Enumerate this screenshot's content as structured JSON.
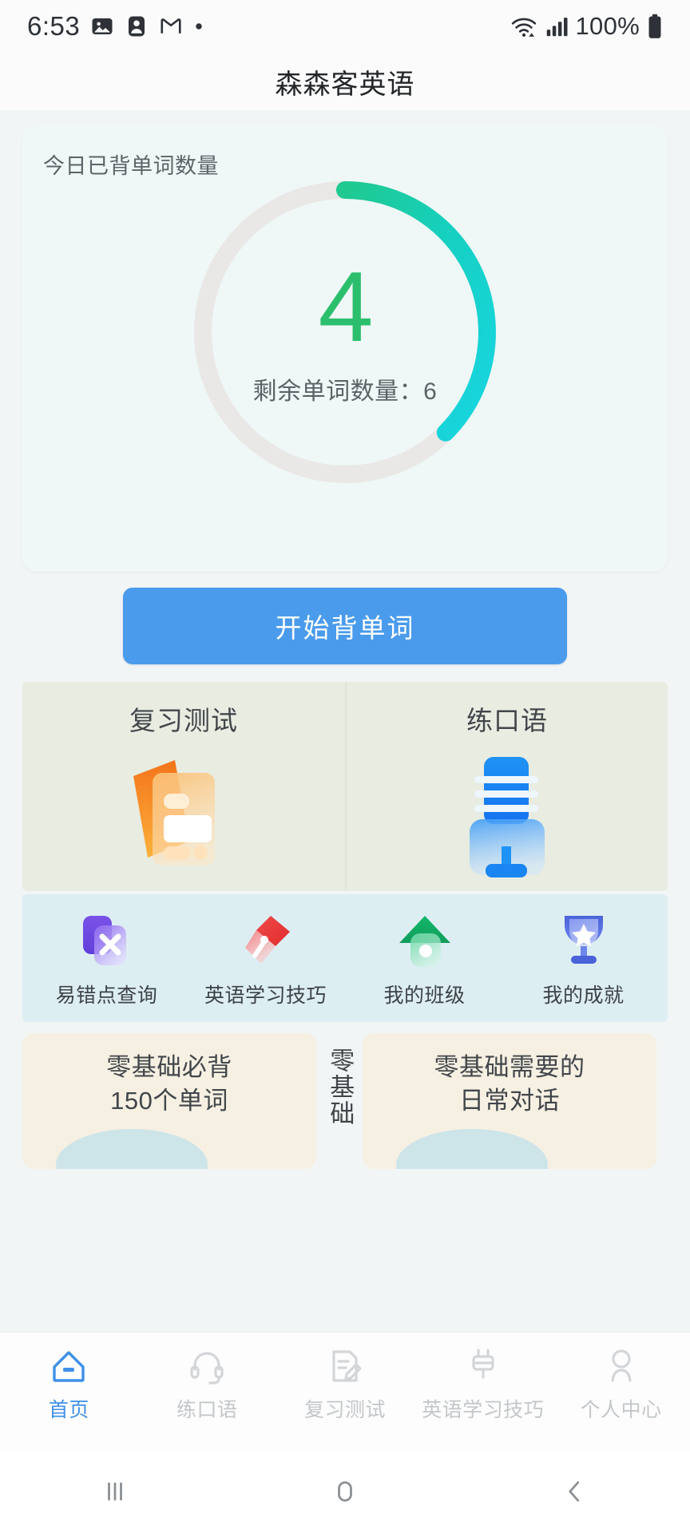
{
  "statusbar": {
    "time": "6:53",
    "battery_text": "100%",
    "icons": [
      "photo-icon",
      "contact-icon",
      "gmail-icon",
      "dot-icon",
      "wifi-icon",
      "signal-icon",
      "battery-icon"
    ]
  },
  "header": {
    "title": "森森客英语"
  },
  "progress_card": {
    "label": "今日已背单词数量",
    "count": "4",
    "remaining_text": "剩余单词数量：6",
    "learned": 4,
    "remaining": 6,
    "total": 10,
    "percent": 40,
    "track_color": "#eae8e6",
    "arc_start_color": "#1fc98f",
    "arc_end_color": "#18d6e2",
    "count_color": "#2bbf6d",
    "card_bg": "#eff7f7"
  },
  "primary_button": {
    "label": "开始背单词",
    "color": "#4a9bec"
  },
  "panels": [
    {
      "label": "复习测试",
      "icon": "flashcards-icon",
      "accent": "#f08a21"
    },
    {
      "label": "练口语",
      "icon": "microphone-icon",
      "accent": "#1688f0"
    }
  ],
  "quick_actions": [
    {
      "label": "易错点查询",
      "icon": "mistake-x-icon",
      "accent": "#7a52e8"
    },
    {
      "label": "英语学习技巧",
      "icon": "pen-tip-icon",
      "accent": "#ef3b3b"
    },
    {
      "label": "我的班级",
      "icon": "house-icon",
      "accent": "#15b36a"
    },
    {
      "label": "我的成就",
      "icon": "trophy-star-icon",
      "accent": "#4a63d8"
    }
  ],
  "courses": {
    "left": {
      "line1": "零基础必背",
      "line2": "150个单词"
    },
    "middle": {
      "text": "零基础"
    },
    "right": {
      "line1": "零基础需要的",
      "line2": "日常对话"
    }
  },
  "tabbar": {
    "active_color": "#3f90e8",
    "inactive_color": "#c3c7ca",
    "items": [
      {
        "label": "首页",
        "icon": "home-icon",
        "active": true
      },
      {
        "label": "练口语",
        "icon": "headset-icon",
        "active": false
      },
      {
        "label": "复习测试",
        "icon": "note-edit-icon",
        "active": false
      },
      {
        "label": "英语学习技巧",
        "icon": "plug-icon",
        "active": false
      },
      {
        "label": "个人中心",
        "icon": "person-icon",
        "active": false
      }
    ]
  },
  "system_nav": [
    {
      "name": "recents-button",
      "icon": "recents-icon"
    },
    {
      "name": "home-button",
      "icon": "home-square-icon"
    },
    {
      "name": "back-button",
      "icon": "back-chevron-icon"
    }
  ]
}
